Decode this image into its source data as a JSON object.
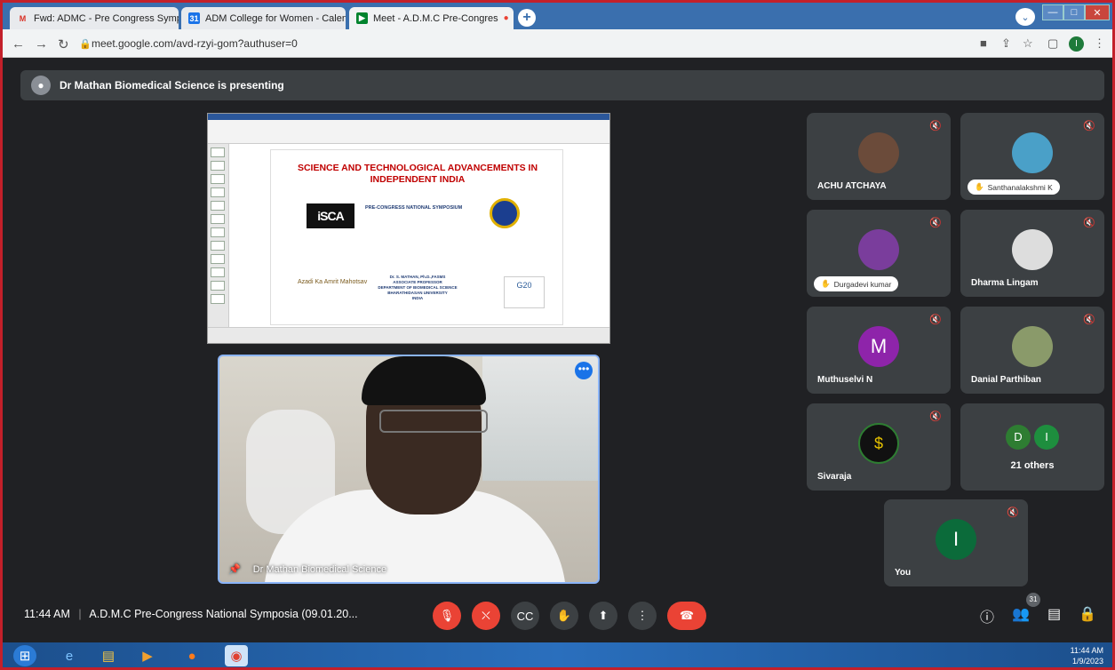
{
  "browser": {
    "tabs": [
      {
        "label": "Fwd: ADMC - Pre Congress Symp",
        "icon": "gmail-icon"
      },
      {
        "label": "ADM College for Women - Calen",
        "icon": "calendar-icon"
      },
      {
        "label": "Meet - A.D.M.C Pre-Congres",
        "icon": "meet-icon"
      }
    ],
    "url": "meet.google.com/avd-rzyi-gom?authuser=0",
    "profile_initial": "I"
  },
  "presenting": {
    "text": "Dr Mathan Biomedical Science is presenting"
  },
  "slide": {
    "title": "SCIENCE AND TECHNOLOGICAL ADVANCEMENTS IN INDEPENDENT INDIA",
    "symposium": "PRE-CONGRESS NATIONAL SYMPOSIUM",
    "left_logo": "iSCA",
    "azadi": "Azadi Ka Amrit Mahotsav",
    "author_lines": [
      "Dr. S. MATHAN, Ph.D.,FASMS",
      "ASSOCIATE PROFESSOR",
      "DEPARTMENT OF BIOMEDICAL SCIENCE",
      "BHARATHIDASAN UNIVERSITY",
      "INDIA"
    ],
    "g20": "G20"
  },
  "presenter": {
    "name": "Dr Mathan Biomedical Science"
  },
  "participants": [
    {
      "name": "ACHU ATCHAYA",
      "style": "plain"
    },
    {
      "name": "Santhanalakshmi K",
      "style": "pill"
    },
    {
      "name": "Durgadevi kumar",
      "style": "pill"
    },
    {
      "name": "Dharma Lingam",
      "style": "plain"
    },
    {
      "name": "Muthuselvi N",
      "style": "plain",
      "initial": "M"
    },
    {
      "name": "Danial Parthiban",
      "style": "plain"
    },
    {
      "name": "Sivaraja",
      "style": "plain"
    },
    {
      "name": "21 others",
      "style": "plain",
      "initials": [
        "D",
        "I"
      ]
    },
    {
      "name": "You",
      "style": "plain",
      "initial": "I"
    }
  ],
  "bottom_bar": {
    "time": "11:44 AM",
    "meeting_title": "A.D.M.C Pre-Congress National Symposia (09.01.20...",
    "participant_count": "31"
  },
  "taskbar": {
    "time": "11:44 AM",
    "date": "1/9/2023"
  },
  "colors": {
    "meet_bg": "#202124",
    "tile_bg": "#3c4043",
    "end_call": "#ea4335",
    "highlight": "#8ab4f8"
  }
}
